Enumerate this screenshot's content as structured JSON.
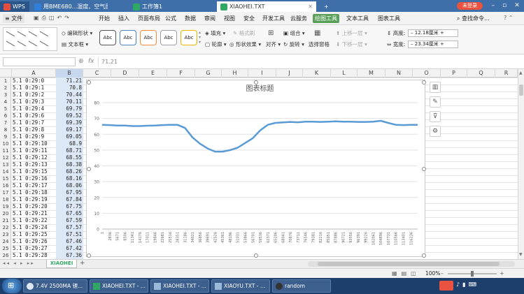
{
  "window": {
    "app_tab": "WPS",
    "tabs": [
      {
        "label": "用BME680...湿度、空气质量",
        "color": "#2f7fdc"
      },
      {
        "label": "工作簿1",
        "color": "#2ea862"
      },
      {
        "label": "XIAOHEI.TXT",
        "color": "#2ea862"
      }
    ],
    "new_tab": "+",
    "login_button": "未登录"
  },
  "menu": {
    "file": "文件",
    "items": [
      "开始",
      "插入",
      "页面布局",
      "公式",
      "数据",
      "审阅",
      "视图",
      "安全",
      "开发工具",
      "云服务",
      "绘图工具",
      "文本工具",
      "图表工具"
    ],
    "active": "绘图工具",
    "search": "查找命令..."
  },
  "ribbon": {
    "edit_shape": "编辑形状",
    "text_box": "文本框",
    "style_label": "Abc",
    "style_colors": [
      "#555555",
      "#4f81bd",
      "#f08c3c",
      "#9aa0a6",
      "#e8b400"
    ],
    "fill": "填充",
    "fill_disabled": "格式刷",
    "outline": "轮廓",
    "shape_effects": "形状效果",
    "align": "对齐",
    "group": "组合",
    "rotate": "旋转",
    "select_pane": "选择窗格",
    "bring_up": "上移一层",
    "send_down": "下移一层",
    "height_label": "高度:",
    "height_value": "12.18厘米",
    "width_label": "宽度:",
    "width_value": "23.34厘米"
  },
  "formula_bar": {
    "fx": "fx",
    "value": "71.21"
  },
  "columns": [
    "A",
    "B",
    "C",
    "D",
    "E",
    "F",
    "G",
    "H",
    "I",
    "J",
    "K",
    "L",
    "M",
    "N",
    "O",
    "P",
    "Q",
    "R"
  ],
  "rows": [
    {
      "n": "1",
      "a": "5.1 0:29:0",
      "b": "71.21"
    },
    {
      "n": "2",
      "a": "5.1 0:29:1",
      "b": "70.8"
    },
    {
      "n": "3",
      "a": "5.1 0:29:2",
      "b": "70.44"
    },
    {
      "n": "4",
      "a": "5.1 0:29:3",
      "b": "70.11"
    },
    {
      "n": "5",
      "a": "5.1 0:29:4",
      "b": "69.79"
    },
    {
      "n": "6",
      "a": "5.1 0:29:6",
      "b": "69.52"
    },
    {
      "n": "7",
      "a": "5.1 0:29:7",
      "b": "69.39"
    },
    {
      "n": "8",
      "a": "5.1 0:29:8",
      "b": "69.17"
    },
    {
      "n": "9",
      "a": "5.1 0:29:9",
      "b": "69.05"
    },
    {
      "n": "10",
      "a": "5.1 0:29:10",
      "b": "68.9"
    },
    {
      "n": "11",
      "a": "5.1 0:29:11",
      "b": "68.71"
    },
    {
      "n": "12",
      "a": "5.1 0:29:12",
      "b": "68.55"
    },
    {
      "n": "13",
      "a": "5.1 0:29:13",
      "b": "68.38"
    },
    {
      "n": "14",
      "a": "5.1 0:29:15",
      "b": "68.26"
    },
    {
      "n": "15",
      "a": "5.1 0:29:16",
      "b": "68.16"
    },
    {
      "n": "16",
      "a": "5.1 0:29:17",
      "b": "68.06"
    },
    {
      "n": "17",
      "a": "5.1 0:29:18",
      "b": "67.95"
    },
    {
      "n": "18",
      "a": "5.1 0:29:19",
      "b": "67.84"
    },
    {
      "n": "19",
      "a": "5.1 0:29:20",
      "b": "67.75"
    },
    {
      "n": "20",
      "a": "5.1 0:29:21",
      "b": "67.65"
    },
    {
      "n": "21",
      "a": "5.1 0:29:22",
      "b": "67.59"
    },
    {
      "n": "22",
      "a": "5.1 0:29:24",
      "b": "67.57"
    },
    {
      "n": "23",
      "a": "5.1 0:29:25",
      "b": "67.51"
    },
    {
      "n": "24",
      "a": "5.1 0:29:26",
      "b": "67.46"
    },
    {
      "n": "25",
      "a": "5.1 0:29:27",
      "b": "67.42"
    },
    {
      "n": "26",
      "a": "5.1 0:29:28",
      "b": "67.36"
    }
  ],
  "chart_data": {
    "type": "line",
    "title": "图表标题",
    "ylim": [
      0,
      80
    ],
    "yticks": [
      0,
      10,
      20,
      30,
      40,
      50,
      60,
      70,
      80
    ],
    "grid": true,
    "x_tick_labels": [
      "1",
      "2836",
      "5671",
      "8506",
      "11341",
      "14176",
      "17011",
      "19846",
      "22681",
      "25516",
      "28351",
      "31186",
      "34021",
      "36856",
      "39691",
      "42526",
      "45361",
      "48196",
      "51031",
      "53866",
      "56701",
      "59536",
      "62371",
      "65206",
      "68041",
      "70876",
      "73711",
      "76546",
      "79381",
      "82216",
      "85051",
      "87886",
      "90721",
      "93556",
      "96391",
      "99226",
      "102061",
      "104896",
      "107731",
      "110566",
      "113401",
      "116236"
    ],
    "series": [
      {
        "color": "#5b9bd5",
        "x": [
          1,
          2836,
          5671,
          8506,
          11341,
          14176,
          17011,
          19846,
          22681,
          25516,
          28351,
          31186,
          34021,
          36856,
          39691,
          42526,
          45361,
          48196,
          51031,
          53866,
          56701,
          59536,
          62371,
          65206,
          68041,
          70876,
          73711,
          76546,
          79381,
          82216,
          85051,
          87886,
          90721,
          93556,
          96391,
          99226,
          102061,
          104896,
          107731,
          110566,
          113401,
          116236,
          118800
        ],
        "y": [
          66,
          65.8,
          65.5,
          65.5,
          65.2,
          65.2,
          65.4,
          65.5,
          65.8,
          66,
          66,
          64,
          58,
          54,
          51,
          49,
          49,
          50,
          51.5,
          54.5,
          57.5,
          62.5,
          66,
          67.2,
          67.5,
          67.8,
          67.6,
          68,
          68,
          67.8,
          68,
          68.2,
          68,
          68,
          67.8,
          67.8,
          68,
          68.5,
          67.2,
          66,
          65.8,
          66,
          66
        ]
      }
    ]
  },
  "sheet_tabs": {
    "active": "XIAOHEI",
    "add": "+"
  },
  "status": {
    "zoom": "100%"
  },
  "taskbar": {
    "items": [
      "7.4V 2500MA 锂...",
      "XIAOHEI.TXT - ...",
      "XIAOHEI.TXT - ...",
      "XIAOYU.TXT - ...",
      "random"
    ]
  }
}
